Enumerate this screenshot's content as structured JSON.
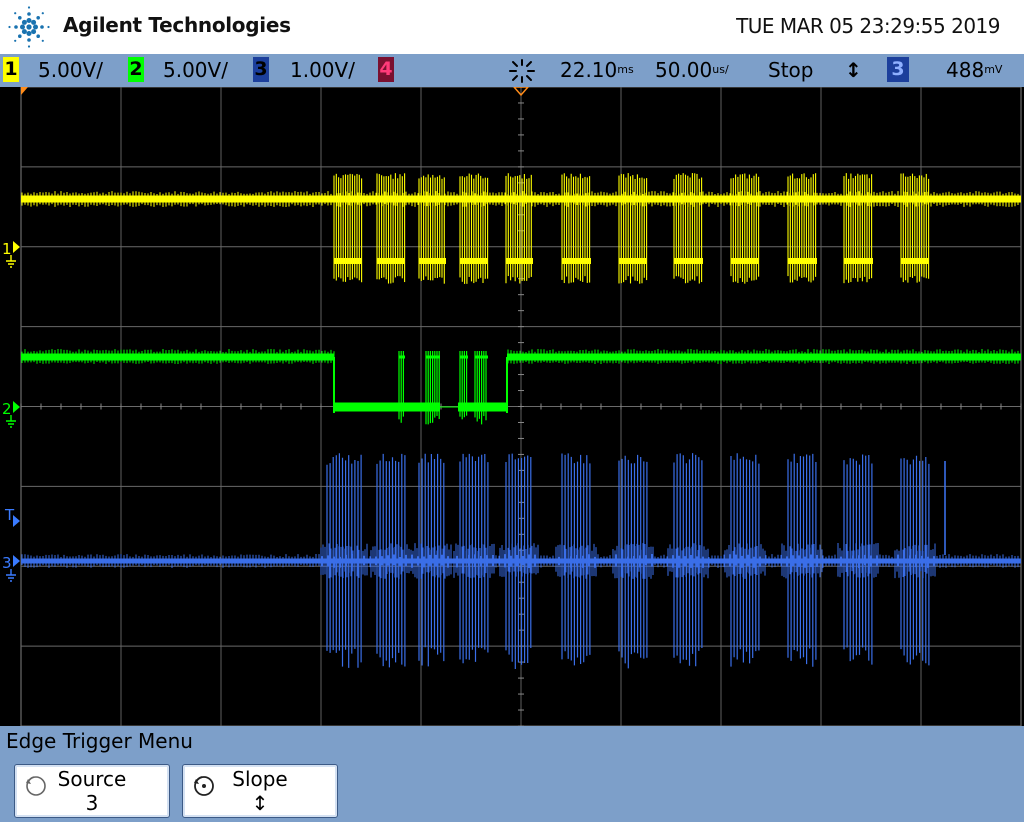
{
  "header": {
    "brand": "Agilent Technologies",
    "datetime": "TUE MAR 05 23:29:55 2019"
  },
  "status": {
    "channels": [
      {
        "num": "1",
        "scale": "5.00V/",
        "color": "#ffff00"
      },
      {
        "num": "2",
        "scale": "5.00V/",
        "color": "#00ff00"
      },
      {
        "num": "3",
        "scale": "1.00V/",
        "color": "#3a6ee8"
      },
      {
        "num": "4",
        "scale": "",
        "color": "#ff1e6e"
      }
    ],
    "delay": "22.10",
    "delay_unit": "ms",
    "timebase": "50.00",
    "timebase_unit": "us/",
    "run_state": "Stop",
    "trigger_slope": "↕",
    "trigger_source": "3",
    "trigger_level": "488",
    "trigger_level_unit": "mV"
  },
  "markers": {
    "ch1": "1",
    "ch2": "2",
    "ch3": "3",
    "trigger": "T"
  },
  "menu": {
    "title": "Edge Trigger Menu",
    "softkeys": [
      {
        "label": "Source",
        "value": "3"
      },
      {
        "label": "Slope",
        "value": "↕"
      }
    ]
  }
}
